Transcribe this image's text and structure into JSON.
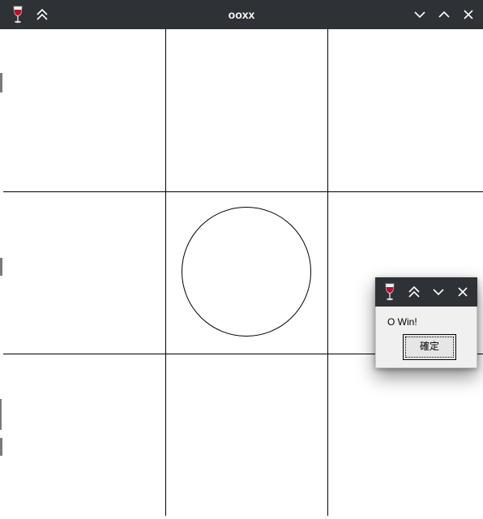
{
  "window": {
    "title": "ooxx",
    "app_icon": "wine-glass-icon",
    "controls": [
      "shade-icon",
      "minimize-icon",
      "maximize-icon",
      "close-icon"
    ]
  },
  "board": {
    "rows": 3,
    "cols": 3,
    "cells": [
      [
        "",
        "",
        ""
      ],
      [
        "",
        "O",
        ""
      ],
      [
        "",
        "",
        ""
      ]
    ]
  },
  "dialog": {
    "app_icon": "wine-glass-icon",
    "controls": [
      "shade-icon",
      "minimize-icon",
      "close-icon"
    ],
    "message": "O Win!",
    "ok_label": "確定"
  },
  "colors": {
    "titlebar": "#2e3135",
    "title_text": "#ffffff",
    "grid_line": "#000000",
    "board_bg": "#ffffff",
    "dialog_body": "#f0f0f0"
  }
}
